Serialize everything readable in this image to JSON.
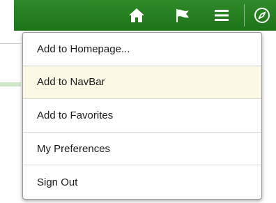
{
  "header": {
    "icons": {
      "home": "home-icon",
      "flag": "flag-icon",
      "menu": "hamburger-menu-icon",
      "navbar": "compass-icon"
    },
    "bar_color": "#26801f"
  },
  "menu": {
    "items": [
      {
        "label": "Add to Homepage..."
      },
      {
        "label": "Add to NavBar",
        "selected": true
      },
      {
        "label": "Add to Favorites"
      },
      {
        "label": "My Preferences"
      },
      {
        "label": "Sign Out"
      }
    ],
    "highlight_color": "#fbf9e4"
  }
}
